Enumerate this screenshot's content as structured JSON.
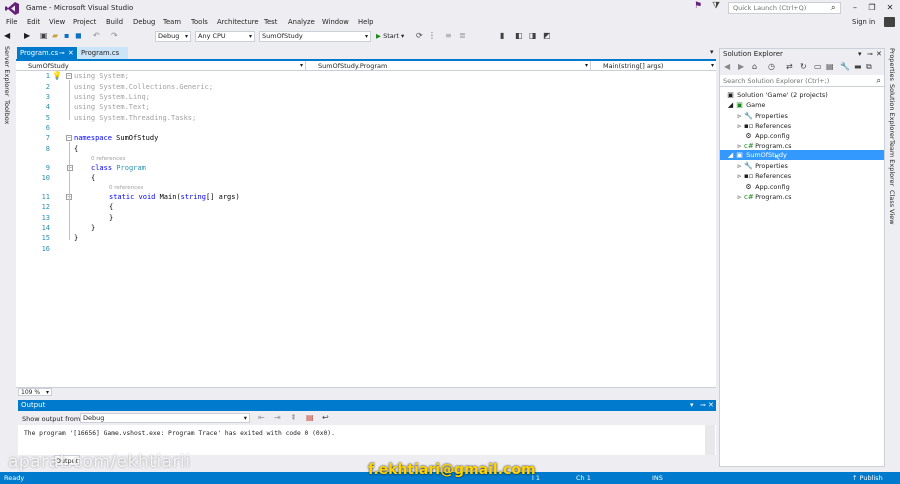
{
  "window": {
    "title": "Game - Microsoft Visual Studio",
    "quick_launch_placeholder": "Quick Launch (Ctrl+Q)",
    "sign_in": "Sign in"
  },
  "menu": [
    "File",
    "Edit",
    "View",
    "Project",
    "Build",
    "Debug",
    "Team",
    "Tools",
    "Architecture",
    "Test",
    "Analyze",
    "Window",
    "Help"
  ],
  "toolbar": {
    "config": "Debug",
    "platform": "Any CPU",
    "startup": "SumOfStudy",
    "start": "Start"
  },
  "left_tabs": [
    "Server Explorer",
    "Toolbox"
  ],
  "right_tabs": [
    "Properties",
    "Solution Explorer",
    "Team Explorer",
    "Class View"
  ],
  "doc_tabs": [
    "Program.cs",
    "Program.cs"
  ],
  "nav": {
    "project": "SumOfStudy",
    "type": "SumOfStudy.Program",
    "member": "Main(string[] args)"
  },
  "code": {
    "line_numbers": [
      "1",
      "2",
      "3",
      "4",
      "5",
      "6",
      "7",
      "8",
      "9",
      "10",
      "11",
      "12",
      "13",
      "14",
      "15",
      "16"
    ],
    "using_kw": "using",
    "usings": [
      "System;",
      "System.Collections.Generic;",
      "System.Linq;",
      "System.Text;",
      "System.Threading.Tasks;"
    ],
    "namespace_kw": "namespace",
    "namespace_name": "SumOfStudy",
    "open_brace": "{",
    "close_brace": "}",
    "refs": "0 references",
    "class_kw": "class",
    "class_name": "Program",
    "static_kw": "static",
    "void_kw": "void",
    "method": "Main(",
    "string_kw": "string",
    "params": "[] args)"
  },
  "zoom": "109 %",
  "output": {
    "title": "Output",
    "show_from_label": "Show output from:",
    "source": "Debug",
    "lines": [
      "The program '[16656] Game.vshost.exe: Program Trace' has exited with code 0 (0x0)."
    ],
    "bottom_tab": "Output"
  },
  "solution_explorer": {
    "title": "Solution Explorer",
    "search_placeholder": "Search Solution Explorer (Ctrl+;)",
    "items": [
      {
        "label": "Solution 'Game' (2 projects)"
      },
      {
        "label": "Game"
      },
      {
        "label": "Properties"
      },
      {
        "label": "References"
      },
      {
        "label": "App.config"
      },
      {
        "label": "Program.cs"
      },
      {
        "label": "SumOfStudy"
      },
      {
        "label": "Properties"
      },
      {
        "label": "References"
      },
      {
        "label": "App.config"
      },
      {
        "label": "Program.cs"
      }
    ]
  },
  "status": {
    "left": "Ready",
    "col": "Ch 1",
    "ins": "INS",
    "publish": "Publish",
    "ln_fragment": "l 1"
  },
  "watermark": {
    "site": "aparat.com/ekhtiarii",
    "email": "f.ekhtiari@gmail.com"
  },
  "colors": {
    "accent": "#007acc",
    "selection": "#3399ff",
    "keyword": "#0000ff",
    "type": "#2b91af",
    "email_watermark": "#ffd400"
  }
}
